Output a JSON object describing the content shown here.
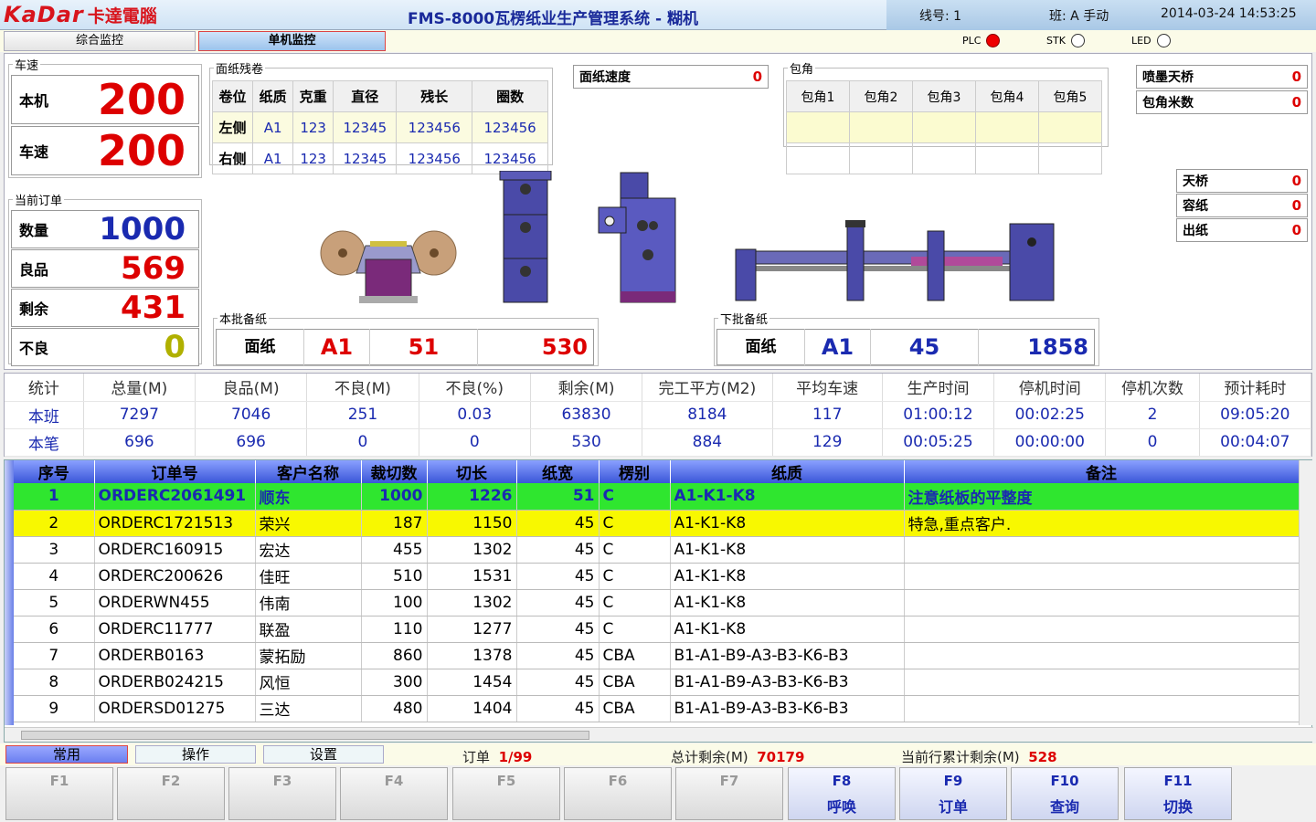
{
  "header": {
    "logo_en": "KaDar",
    "logo_cn": "卡達電腦",
    "title": "FMS-8000瓦楞纸业生产管理系统 - 糊机",
    "line": "线号: 1",
    "shift": "班: A 手动",
    "datetime": "2014-03-24 14:53:25"
  },
  "tabs": {
    "t1": "综合监控",
    "t2": "单机监控"
  },
  "indicators": {
    "plc": "PLC",
    "stk": "STK",
    "led": "LED"
  },
  "speed": {
    "legend": "车速",
    "local_label": "本机",
    "local": "200",
    "car_label": "车速",
    "car": "200"
  },
  "order": {
    "legend": "当前订单",
    "qty_label": "数量",
    "qty": "1000",
    "good_label": "良品",
    "good": "569",
    "remain_label": "剩余",
    "remain": "431",
    "bad_label": "不良",
    "bad": "0"
  },
  "roll": {
    "legend": "面纸残卷",
    "headers": [
      "卷位",
      "纸质",
      "克重",
      "直径",
      "残长",
      "圈数"
    ],
    "rows": [
      [
        "左侧",
        "A1",
        "123",
        "12345",
        "123456",
        "123456"
      ],
      [
        "右侧",
        "A1",
        "123",
        "12345",
        "123456",
        "123456"
      ]
    ]
  },
  "paper_speed": {
    "label": "面纸速度",
    "value": "0"
  },
  "wrap": {
    "legend": "包角",
    "headers": [
      "包角1",
      "包角2",
      "包角3",
      "包角4",
      "包角5"
    ]
  },
  "spray": {
    "label": "喷墨天桥",
    "value": "0"
  },
  "wrap_m": {
    "label": "包角米数",
    "value": "0"
  },
  "bridge": {
    "label": "天桥",
    "value": "0"
  },
  "capacity": {
    "label": "容纸",
    "value": "0"
  },
  "out": {
    "label": "出纸",
    "value": "0"
  },
  "batch": {
    "legend": "本批备纸",
    "label": "面纸",
    "p": "A1",
    "n1": "51",
    "n2": "530"
  },
  "next": {
    "legend": "下批备纸",
    "label": "面纸",
    "p": "A1",
    "n1": "45",
    "n2": "1858"
  },
  "stats": {
    "headers": [
      "统计",
      "总量(M)",
      "良品(M)",
      "不良(M)",
      "不良(%)",
      "剩余(M)",
      "完工平方(M2)",
      "平均车速",
      "生产时间",
      "停机时间",
      "停机次数",
      "预计耗时"
    ],
    "rows": [
      [
        "本班",
        "7297",
        "7046",
        "251",
        "0.03",
        "63830",
        "8184",
        "117",
        "01:00:12",
        "00:02:25",
        "2",
        "09:05:20"
      ],
      [
        "本笔",
        "696",
        "696",
        "0",
        "0",
        "530",
        "884",
        "129",
        "00:05:25",
        "00:00:00",
        "0",
        "00:04:07"
      ]
    ]
  },
  "orders": {
    "headers": [
      "序号",
      "订单号",
      "客户名称",
      "裁切数",
      "切长",
      "纸宽",
      "楞别",
      "纸质",
      "备注"
    ],
    "rows": [
      [
        "1",
        "ORDERC2061491",
        "顺东",
        "1000",
        "1226",
        "51",
        "C",
        "A1-K1-K8",
        "注意纸板的平整度"
      ],
      [
        "2",
        "ORDERC1721513",
        "荣兴",
        "187",
        "1150",
        "45",
        "C",
        "A1-K1-K8",
        "特急,重点客户."
      ],
      [
        "3",
        "ORDERC160915",
        "宏达",
        "455",
        "1302",
        "45",
        "C",
        "A1-K1-K8",
        ""
      ],
      [
        "4",
        "ORDERC200626",
        "佳旺",
        "510",
        "1531",
        "45",
        "C",
        "A1-K1-K8",
        ""
      ],
      [
        "5",
        "ORDERWN455",
        "伟南",
        "100",
        "1302",
        "45",
        "C",
        "A1-K1-K8",
        ""
      ],
      [
        "6",
        "ORDERC11777",
        "联盈",
        "110",
        "1277",
        "45",
        "C",
        "A1-K1-K8",
        ""
      ],
      [
        "7",
        "ORDERB0163",
        "蒙拓励",
        "860",
        "1378",
        "45",
        "CBA",
        "B1-A1-B9-A3-B3-K6-B3",
        ""
      ],
      [
        "8",
        "ORDERB024215",
        "风恒",
        "300",
        "1454",
        "45",
        "CBA",
        "B1-A1-B9-A3-B3-K6-B3",
        ""
      ],
      [
        "9",
        "ORDERSD01275",
        "三达",
        "480",
        "1404",
        "45",
        "CBA",
        "B1-A1-B9-A3-B3-K6-B3",
        ""
      ]
    ]
  },
  "bottom": {
    "tab1": "常用",
    "tab2": "操作",
    "tab3": "设置",
    "order_label": "订单",
    "order_val": "1/99",
    "total_label": "总计剩余(M)",
    "total_val": "70179",
    "cur_label": "当前行累计剩余(M)",
    "cur_val": "528"
  },
  "fkeys": [
    {
      "k": "F1",
      "s": ""
    },
    {
      "k": "F2",
      "s": ""
    },
    {
      "k": "F3",
      "s": ""
    },
    {
      "k": "F4",
      "s": ""
    },
    {
      "k": "F5",
      "s": ""
    },
    {
      "k": "F6",
      "s": ""
    },
    {
      "k": "F7",
      "s": ""
    },
    {
      "k": "F8",
      "s": "呼唤"
    },
    {
      "k": "F9",
      "s": "订单"
    },
    {
      "k": "F10",
      "s": "查询"
    },
    {
      "k": "F11",
      "s": "切换"
    }
  ]
}
